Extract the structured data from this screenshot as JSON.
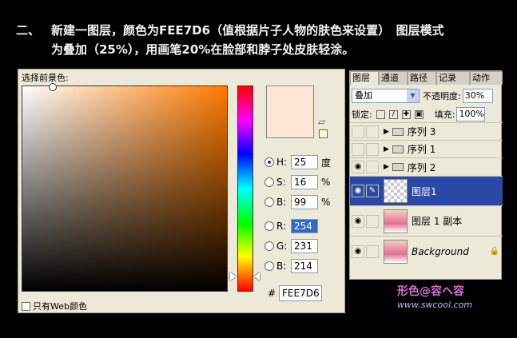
{
  "caption": {
    "number": "二、",
    "line1": "新建一图层，颜色为FEE7D6（值根据片子人物的肤色来设置）　图层模式",
    "line2": "为叠加（25%），用画笔20%在脸部和脖子处皮肤轻涂。"
  },
  "picker": {
    "title": "选择前景色:",
    "current_color": "#fee7d6",
    "fields": [
      {
        "label": "H:",
        "value": "25",
        "unit": "度",
        "selected": true
      },
      {
        "label": "S:",
        "value": "16",
        "unit": "%",
        "selected": false
      },
      {
        "label": "B:",
        "value": "99",
        "unit": "%",
        "selected": false
      },
      {
        "label": "R:",
        "value": "254",
        "unit": "",
        "selected": false
      },
      {
        "label": "G:",
        "value": "231",
        "unit": "",
        "selected": false
      },
      {
        "label": "B:",
        "value": "214",
        "unit": "",
        "selected": false
      }
    ],
    "hex_label": "#",
    "hex_value": "FEE7D6",
    "web_only_label": "只有Web颜色"
  },
  "layers": {
    "tabs": [
      "图层",
      "通道",
      "路径",
      "记录",
      "动作"
    ],
    "blend_mode": "叠加",
    "opacity_label": "不透明度:",
    "opacity_value": "30%",
    "lock_label": "锁定:",
    "fill_label": "填充:",
    "fill_value": "100%",
    "rows": [
      {
        "name": "序列 3",
        "kind": "group"
      },
      {
        "name": "序列 1",
        "kind": "group"
      },
      {
        "name": "序列 2",
        "kind": "group"
      },
      {
        "name": "图层1",
        "kind": "layer"
      },
      {
        "name": "图层 1 副本",
        "kind": "photo"
      },
      {
        "name": "Background",
        "kind": "background"
      }
    ]
  },
  "watermark": {
    "brand": "形色@容ヘ容",
    "site": "www.swcool.com"
  }
}
